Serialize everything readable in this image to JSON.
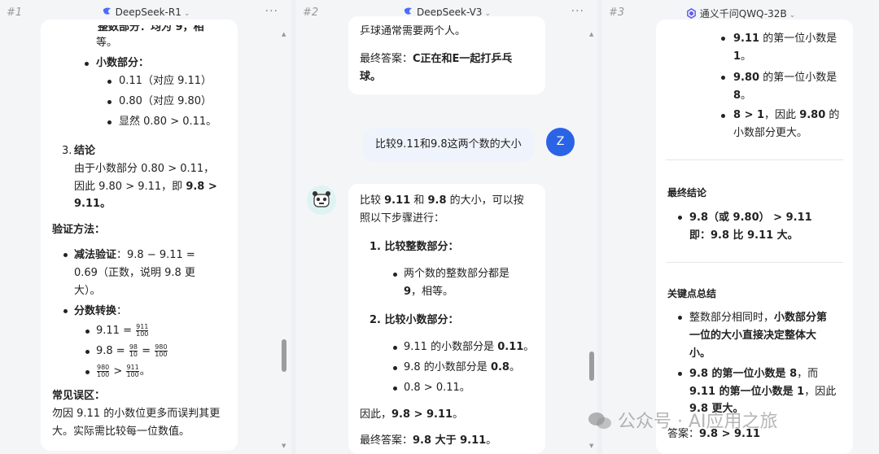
{
  "panes": [
    {
      "num": "#1",
      "model": "DeepSeek-R1",
      "lines": {
        "top_cut": "整数部分：均为 9，相",
        "l_deng": "等。",
        "frac_title": "小数部分：",
        "frac_a": "0.11（对应 9.11）",
        "frac_b": "0.80（对应 9.80）",
        "frac_c": "显然 0.80 > 0.11。",
        "concl_num": "3.",
        "concl_title": "结论",
        "concl_1": "由于小数部分 0.80 > 0.11，",
        "concl_2a": "因此 9.80 > 9.11，即",
        "concl_2b": "9.8 >",
        "concl_3": "9.11。",
        "verify": "验证方法：",
        "sub_title": "减法验证",
        "sub_1": "：9.8 − 9.11 =",
        "sub_2": "0.69（正数，说明 9.8 更",
        "sub_3": "大）。",
        "conv_title": "分数转换",
        "conv_colon": "：",
        "c1_pre": "9.11 =",
        "c1_num": "911",
        "c1_den": "100",
        "c2_pre": "9.8 =",
        "c2_n1": "98",
        "c2_d1": "10",
        "c2_eq": "=",
        "c2_n2": "980",
        "c2_d2": "100",
        "c3_n1": "980",
        "c3_d1": "100",
        "c3_gt": ">",
        "c3_n2": "911",
        "c3_d2": "100",
        "c3_end": "。",
        "mis_title": "常见误区：",
        "mis_1": "勿因 9.11 的小数位更多而误判其更",
        "mis_2": "大。实际需比较每一位数值。"
      }
    },
    {
      "num": "#2",
      "model": "DeepSeek-V3",
      "lines": {
        "top_cut": "乒球通常需要两个人。",
        "final_label": "最终答案：",
        "final_val": "C正在和E一起打乒乓",
        "final_val2": "球。",
        "user_msg": "比较9.11和9.8这两个数的大小",
        "user_avatar": "Z",
        "a_1a": "比较 ",
        "a_1b": "9.11",
        "a_1c": " 和 ",
        "a_1d": "9.8",
        "a_1e": " 的大小，可以按",
        "a_2": "照以下步骤进行：",
        "s1": "1. 比较整数部分：",
        "s1_b1": "两个数的整数部分都是",
        "s1_b2a": "9",
        "s1_b2b": "，相等。",
        "s2": "2. 比较小数部分：",
        "s2_b1a": "9.11 的小数部分是 ",
        "s2_b1b": "0.11",
        "s2_b1c": "。",
        "s2_b2a": "9.8 的小数部分是 ",
        "s2_b2b": "0.8",
        "s2_b2c": "。",
        "s2_b3": "0.8 > 0.11。",
        "therefore_a": "因此，",
        "therefore_b": "9.8 > 9.11",
        "therefore_c": "。",
        "final2_a": "最终答案：",
        "final2_b": "9.8 大于 9.11",
        "final2_c": "。"
      }
    },
    {
      "num": "#3",
      "model": "通义千问QWQ-32B",
      "lines": {
        "b1a": "9.11",
        "b1b": " 的第一位小数是",
        "b1c": "1",
        "b1d": "。",
        "b2a": "9.80",
        "b2b": " 的第一位小数是",
        "b2c": "8",
        "b2d": "。",
        "b3a": "8 > 1",
        "b3b": "，因此 ",
        "b3c": "9.80",
        "b3d": " 的",
        "b3e": "小数部分更大。",
        "final_title": "最终结论",
        "f1a": "9.8（或 9.80）",
        "f1b": "  > 9.11",
        "f2": "即：9.8 比 9.11 大。",
        "key_title": "关键点总结",
        "k1a": "整数部分相同时，",
        "k1b": "小数部分第",
        "k1c": "一位的大小直接决定整体大",
        "k1d": "小。",
        "k2a": "9.8 的第一位小数是 8",
        "k2b": "，而",
        "k2c": "9.11 的第一位小数是 1",
        "k2d": "，因此",
        "k2e": "9.8 更大。",
        "ans_a": "答案：",
        "ans_b": "9.8 > 9.11"
      }
    }
  ],
  "watermark": "公众号 · AI应用之旅",
  "colors": {
    "accent": "#4d6bfe",
    "user_bubble": "#eff3fb",
    "avatar_z": "#2b63e6"
  }
}
